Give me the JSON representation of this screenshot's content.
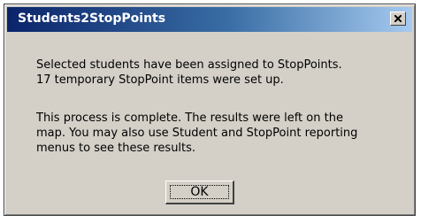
{
  "dialog": {
    "title": "Students2StopPoints",
    "close_icon": "close-icon",
    "message_lines": [
      "Selected students have been assigned to StopPoints.",
      "17 temporary StopPoint items were set up.",
      "This process is complete.  The results were left on the",
      "map.  You may also use Student and StopPoint reporting",
      "menus to see these results."
    ],
    "ok_label": "OK"
  }
}
